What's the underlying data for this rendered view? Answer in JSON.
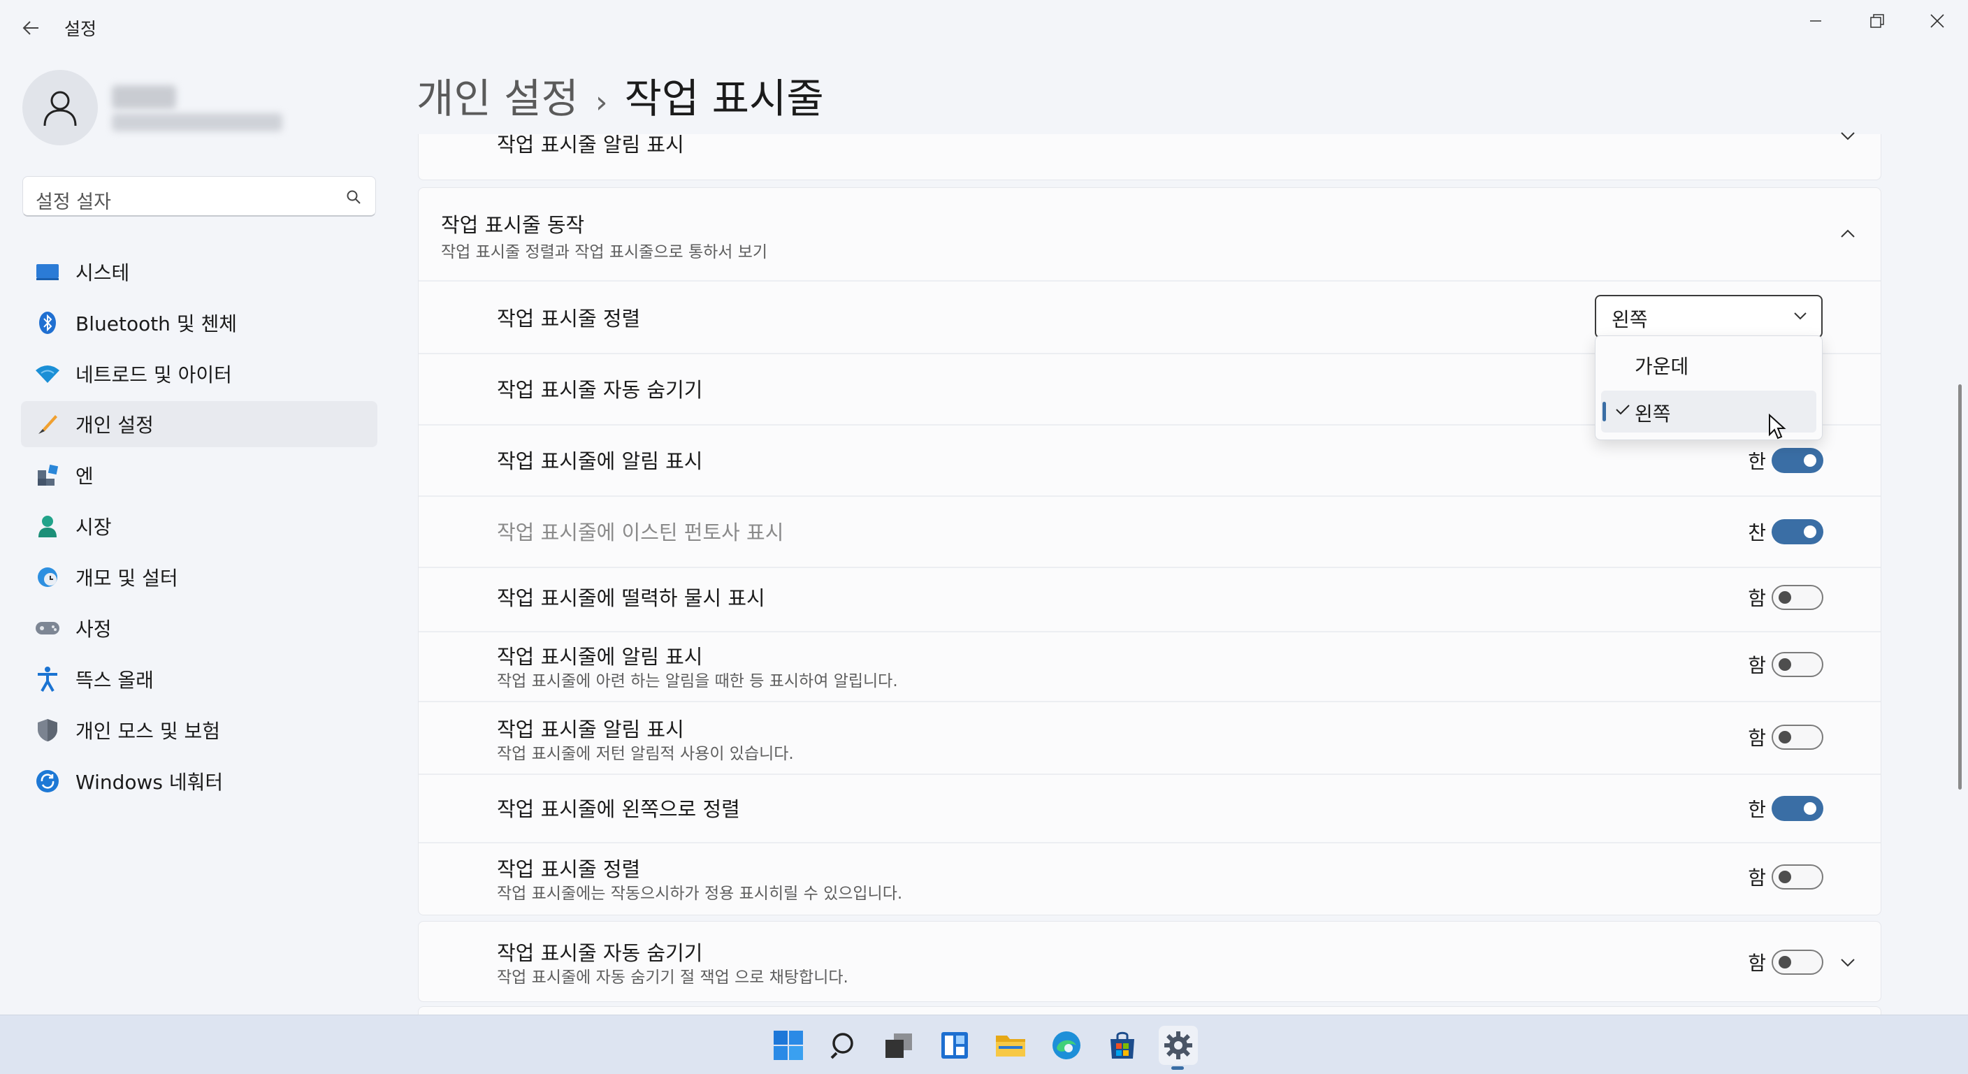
{
  "window": {
    "title": "설정",
    "back_icon": "back-arrow-icon",
    "controls": [
      "minimize-icon",
      "restore-icon",
      "close-icon"
    ]
  },
  "search": {
    "placeholder": "설정 설자"
  },
  "sidebar": {
    "items": [
      {
        "label": "시스테",
        "icon": "system-icon",
        "active": false
      },
      {
        "label": "Bluetooth 및 첸체",
        "icon": "bluetooth-icon",
        "active": false
      },
      {
        "label": "네트로드 및 아이터",
        "icon": "network-icon",
        "active": false
      },
      {
        "label": "개인 설정",
        "icon": "personalization-icon",
        "active": true
      },
      {
        "label": "엔",
        "icon": "apps-icon",
        "active": false
      },
      {
        "label": "시장",
        "icon": "accounts-icon",
        "active": false
      },
      {
        "label": "개모 및 설터",
        "icon": "time-language-icon",
        "active": false
      },
      {
        "label": "사정",
        "icon": "gaming-icon",
        "active": false
      },
      {
        "label": "뜩스 올래",
        "icon": "accessibility-icon",
        "active": false
      },
      {
        "label": "개인 모스 및 보험",
        "icon": "privacy-security-icon",
        "active": false
      },
      {
        "label": "Windows 네훠터",
        "icon": "windows-update-icon",
        "active": false
      }
    ]
  },
  "header": {
    "parent": "개인 설정",
    "separator": "›",
    "current": "작업 표시줄"
  },
  "collapsed_card": {
    "label": "작업 표시줄 알림 표시"
  },
  "behaviors": {
    "title": "작업 표시줄 동작",
    "subtitle": "작업 표시줄 정렬과 작업 표시줄으로 통하서 보기",
    "alignment": {
      "label": "작업 표시줄 정렬",
      "value": "왼쪽"
    },
    "dropdown_options": [
      {
        "label": "가운데",
        "selected": false
      },
      {
        "label": "왼쪽",
        "selected": true
      }
    ],
    "rows": [
      {
        "label": "작업 표시줄 자동 숨기기",
        "sub": "",
        "state": "",
        "on": null,
        "dim": false
      },
      {
        "label": "작업 표시줄에 알림 표시",
        "sub": "",
        "state": "한",
        "on": true,
        "dim": false
      },
      {
        "label": "작업 표시줄에 이스틴 펀토사 표시",
        "sub": "",
        "state": "찬",
        "on": true,
        "dim": true
      },
      {
        "label": "작업 표시줄에 떨력하 물시 표시",
        "sub": "",
        "state": "함",
        "on": false,
        "dim": false
      },
      {
        "label": "작업 표시줄에 알림 표시",
        "sub": "작업 표시줄에 아련 하는 알림을 때한 등 표시하여 알립니다.",
        "state": "함",
        "on": false,
        "dim": false
      },
      {
        "label": "작업 표시줄 알림 표시",
        "sub": "작업 표시줄에 저턴 알림적 사용이 있습니다.",
        "state": "함",
        "on": false,
        "dim": false
      },
      {
        "label": "작업 표시줄에 왼쪽으로 정렬",
        "sub": "",
        "state": "한",
        "on": true,
        "dim": false
      },
      {
        "label": "작업 표시줄 정렬",
        "sub": "작업 표시줄에는 작동으시하가 정용 표시히릴 수 있으입니다.",
        "state": "함",
        "on": false,
        "dim": false
      }
    ]
  },
  "bottom_card": {
    "label": "작업 표시줄 자동 숨기기",
    "sub": "작업 표시줄에 자동 숨기기 절 잭업 으로 채탕합니다.",
    "state": "함",
    "on": false
  },
  "taskbar": {
    "icons": [
      "start-icon",
      "search-icon",
      "task-view-icon",
      "widgets-icon",
      "file-explorer-icon",
      "edge-icon",
      "store-icon",
      "settings-icon"
    ],
    "active": "settings-icon"
  },
  "colors": {
    "accent": "#3a6ea5",
    "background": "#f3f5f9",
    "card": "#fbfbfc"
  }
}
